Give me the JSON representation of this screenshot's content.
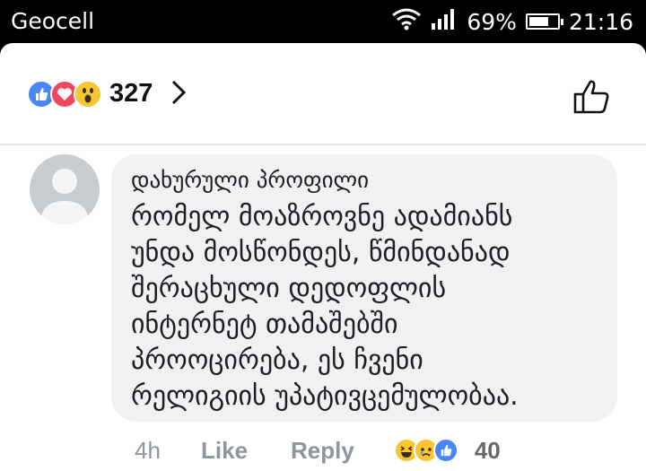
{
  "status_bar": {
    "carrier": "Geocell",
    "battery": "69%",
    "battery_level": 0.69,
    "time": "21:16"
  },
  "header": {
    "reactions": [
      "like-icon",
      "love-icon",
      "wow-icon"
    ],
    "reaction_count": "327",
    "colors": {
      "like": "#4a86f7",
      "love": "#f0475e",
      "wow": "#f7c631"
    }
  },
  "comment": {
    "author": "დახურული პროფილი",
    "lines": [
      "რომელ მოაზროვნე ადამიანს",
      "უნდა მოსწონდეს, წმინდანად",
      "შერაცხული დედოფლის",
      "ინტერნეტ თამაშებში",
      "პროოცირება, ეს ჩვენი",
      "რელიგიის უპატივცემულობაა."
    ],
    "time": "4h",
    "like_label": "Like",
    "reply_label": "Reply",
    "reaction_count": "40",
    "reactions": [
      "haha-icon",
      "sad-icon",
      "like-icon"
    ]
  }
}
